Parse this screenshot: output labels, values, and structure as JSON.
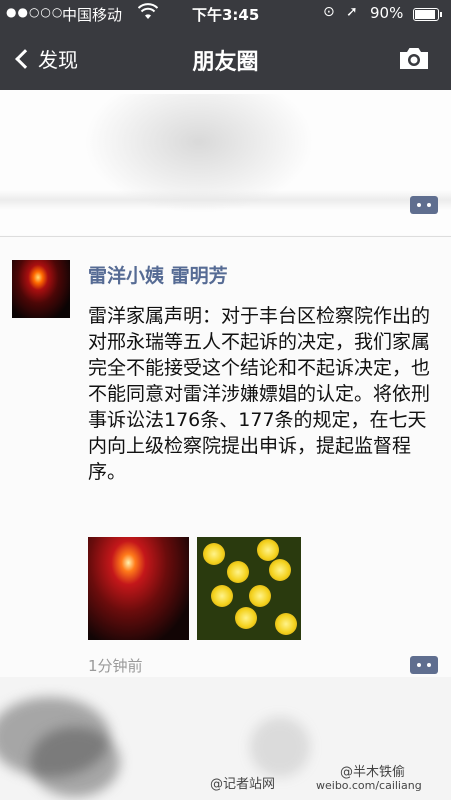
{
  "status_bar": {
    "signal": "●●○○○",
    "carrier": "中国移动",
    "time": "下午3:45",
    "battery_percent": "90%",
    "battery_level": 0.9
  },
  "nav": {
    "back_label": "发现",
    "title": "朋友圈"
  },
  "post": {
    "author": "雷洋小姨 雷明芳",
    "text": "雷洋家属声明：对于丰台区检察院作出的对邢永瑞等五人不起诉的决定，我们家属完全不能接受这个结论和不起诉决定，也不能同意对雷洋涉嫌嫖娼的认定。将依刑事诉讼法176条、177条的规定，在七天内向上级检察院提出申诉，提起监督程序。",
    "timestamp": "1分钟前",
    "photo_count": 2
  },
  "watermarks": {
    "left": "@记者站网",
    "right_top": "@半木铁偷",
    "right_bottom": "weibo.com/cailiang"
  },
  "colors": {
    "nav_background": "#393a3f",
    "author_link": "#566b94",
    "comment_button": "#5f6e8f"
  }
}
